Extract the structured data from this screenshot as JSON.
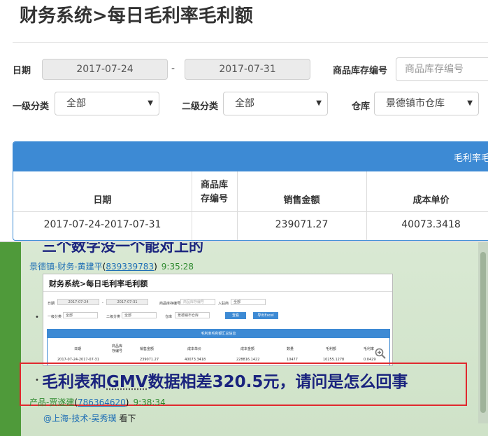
{
  "window": {
    "title": "财务系统>每日毛利率毛利额",
    "filters": {
      "date_label": "日期",
      "date_start": "2017-07-24",
      "date_sep": "-",
      "date_end": "2017-07-31",
      "sku_label": "商品库存编号",
      "sku_placeholder": "商品库存编号",
      "cat1_label": "一级分类",
      "cat1_value": "全部",
      "cat2_label": "二级分类",
      "cat2_value": "全部",
      "warehouse_label": "仓库",
      "warehouse_value": "景德镇市仓库"
    },
    "panel_title": "毛利率毛",
    "table": {
      "headers": [
        "日期",
        "商品库存编号",
        "销售金额",
        "成本单价"
      ],
      "header_sku_line1": "商品库",
      "header_sku_line2": "存编号",
      "row": [
        "2017-07-24-2017-07-31",
        "",
        "239071.27",
        "40073.3418"
      ]
    }
  },
  "chat": {
    "cut_message": "三个数字没一个能对上的",
    "msg1": {
      "name": "景德镇-财务-黄建平",
      "qq": "839339783",
      "time": "9:35:28"
    },
    "thumbnail": {
      "title": "财务系统>每日毛利率毛利额",
      "date_label": "日期",
      "date_start": "2017-07-24",
      "date_end": "2017-07-31",
      "sku_label": "商品库存编号",
      "sku_placeholder": "商品库存编号",
      "in_warehouse_label": "入驻商",
      "in_warehouse_value": "全部",
      "cat1_label": "一级分类",
      "cat1_value": "全部",
      "cat2_label": "二级分类",
      "cat2_value": "全部",
      "warehouse_label": "仓库",
      "warehouse_value": "景德镇市仓库",
      "btn_query": "查看",
      "btn_export": "导出Excel",
      "panel_title": "毛利率毛利额汇总信息",
      "headers": [
        "日期",
        "商品库存编号",
        "销售金额",
        "成本单价",
        "成本金额",
        "数量",
        "毛利额",
        "毛利率"
      ],
      "row": [
        "2017-07-24-2017-07-31",
        "",
        "239071.27",
        "40073.3418",
        "228816.1422",
        "10477",
        "10255.1278",
        "0.0429"
      ]
    },
    "highlight_pre": "毛利表和",
    "highlight_gmv": "GMV",
    "highlight_post": "数据相差320.5元，请问是怎么回事",
    "msg2": {
      "name": "产品-贾遂建",
      "qq": "786364620",
      "time": "9:38:34"
    },
    "mention_at": "@上海-技术-吴秀璞",
    "mention_text": "看下"
  }
}
